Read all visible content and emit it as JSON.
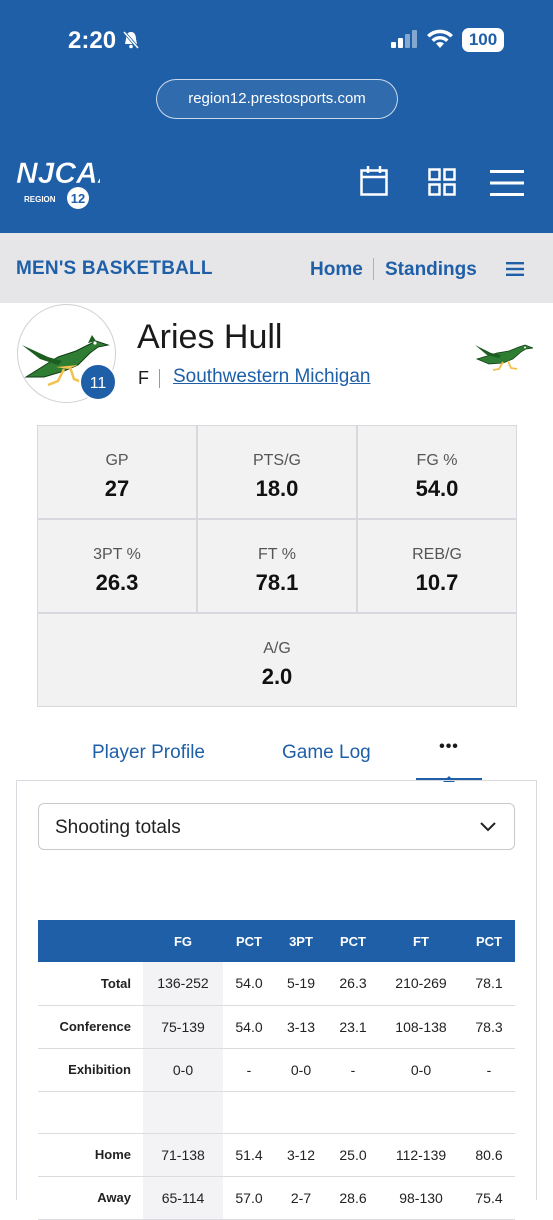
{
  "status_bar": {
    "time": "2:20",
    "battery": "100"
  },
  "browser": {
    "url": "region12.prestosports.com"
  },
  "header": {
    "logo_text": "NJCAA",
    "logo_region": "REGION",
    "logo_number": "12"
  },
  "subnav": {
    "sport": "MEN'S BASKETBALL",
    "home": "Home",
    "standings": "Standings"
  },
  "player": {
    "name": "Aries Hull",
    "number": "11",
    "position": "F",
    "team": "Southwestern Michigan"
  },
  "stats": [
    {
      "label": "GP",
      "value": "27"
    },
    {
      "label": "PTS/G",
      "value": "18.0"
    },
    {
      "label": "FG %",
      "value": "54.0"
    },
    {
      "label": "3PT %",
      "value": "26.3"
    },
    {
      "label": "FT %",
      "value": "78.1"
    },
    {
      "label": "REB/G",
      "value": "10.7"
    },
    {
      "label": "A/G",
      "value": "2.0"
    }
  ],
  "tabs": {
    "profile": "Player Profile",
    "gamelog": "Game Log",
    "more": "•••"
  },
  "dropdown": {
    "selected": "Shooting totals"
  },
  "table": {
    "headers": [
      "",
      "FG",
      "PCT",
      "3PT",
      "PCT",
      "FT",
      "PCT"
    ],
    "rows": [
      [
        "Total",
        "136-252",
        "54.0",
        "5-19",
        "26.3",
        "210-269",
        "78.1"
      ],
      [
        "Conference",
        "75-139",
        "54.0",
        "3-13",
        "23.1",
        "108-138",
        "78.3"
      ],
      [
        "Exhibition",
        "0-0",
        "-",
        "0-0",
        "-",
        "0-0",
        "-"
      ],
      [
        "",
        "",
        "",
        "",
        "",
        "",
        ""
      ],
      [
        "Home",
        "71-138",
        "51.4",
        "3-12",
        "25.0",
        "112-139",
        "80.6"
      ],
      [
        "Away",
        "65-114",
        "57.0",
        "2-7",
        "28.6",
        "98-130",
        "75.4"
      ]
    ]
  },
  "colors": {
    "brand_blue": "#1f5fa8",
    "bird_green": "#2e7d32"
  }
}
